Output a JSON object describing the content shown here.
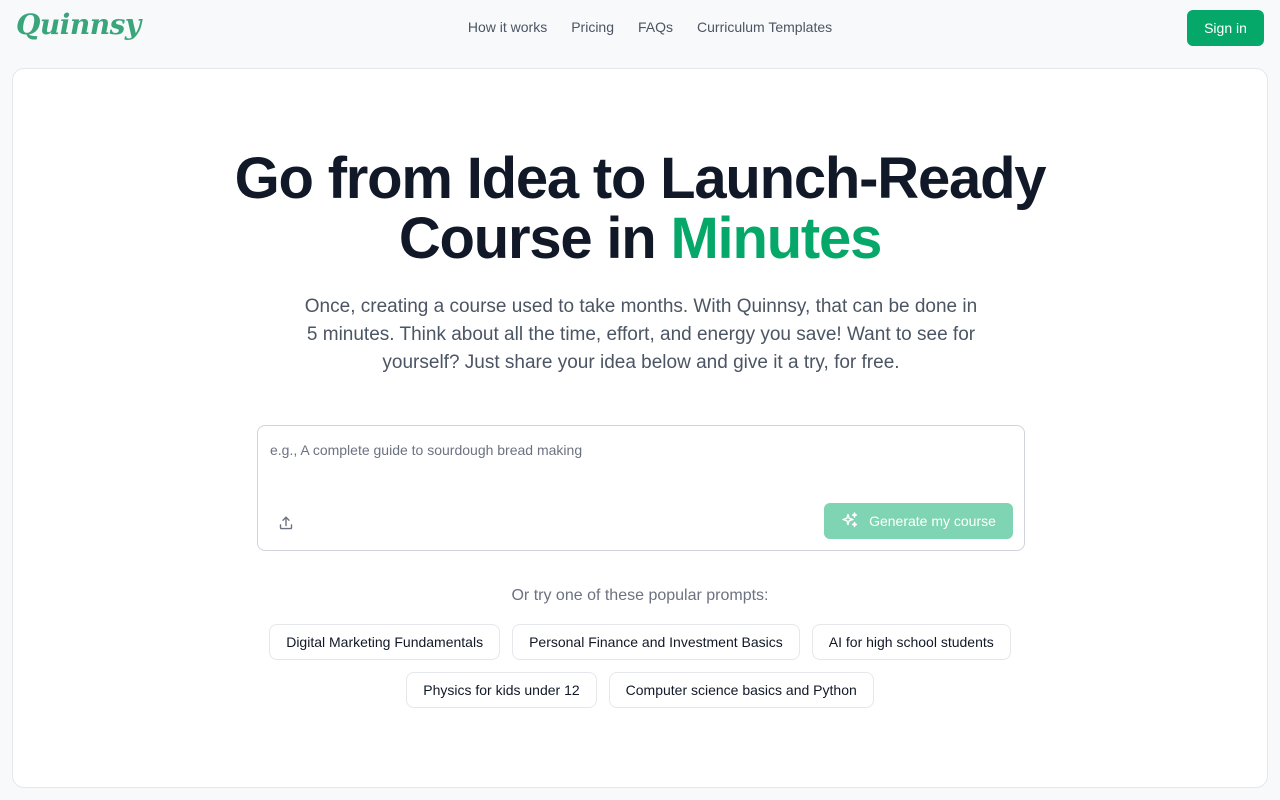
{
  "brand": {
    "name": "Quinnsy"
  },
  "nav": {
    "items": [
      {
        "label": "How it works"
      },
      {
        "label": "Pricing"
      },
      {
        "label": "FAQs"
      },
      {
        "label": "Curriculum Templates"
      }
    ],
    "signin_label": "Sign in"
  },
  "colors": {
    "accent": "#06a86a",
    "accent_disabled": "#7fd4b3",
    "logo": "#3aa57a"
  },
  "hero": {
    "headline_line1": "Go from Idea to Launch-Ready",
    "headline_line2_prefix": "Course in ",
    "headline_accent": "Minutes",
    "subtitle": "Once, creating a course used to take months. With Quinnsy, that can be done in 5 minutes. Think about all the time, effort, and energy you save! Want to see for yourself? Just share your idea below and give it a try, for free."
  },
  "prompt_box": {
    "placeholder": "e.g., A complete guide to sourdough bread making",
    "value": "",
    "upload_icon": "upload-icon",
    "generate_icon": "sparkles-icon",
    "generate_label": "Generate my course"
  },
  "suggestions": {
    "label": "Or try one of these popular prompts:",
    "row1": [
      "Digital Marketing Fundamentals",
      "Personal Finance and Investment Basics",
      "AI for high school students"
    ],
    "row2": [
      "Physics for kids under 12",
      "Computer science basics and Python"
    ]
  }
}
